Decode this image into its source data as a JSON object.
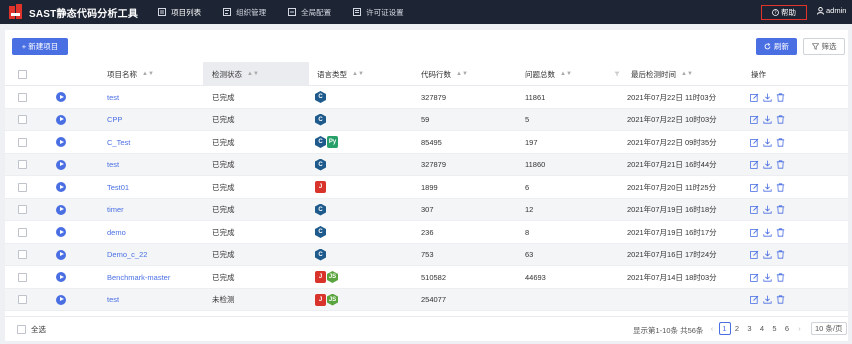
{
  "app": {
    "title": "SAST静态代码分析工具"
  },
  "nav": [
    {
      "label": "项目列表",
      "icon": "list-icon",
      "active": true
    },
    {
      "label": "组织管理",
      "icon": "org-icon",
      "active": false
    },
    {
      "label": "全局配置",
      "icon": "settings-icon",
      "active": false
    },
    {
      "label": "许可证设置",
      "icon": "license-icon",
      "active": false
    }
  ],
  "header": {
    "help_label": "帮助",
    "user_label": "admin"
  },
  "toolbar": {
    "new_label": "+ 新建项目",
    "refresh_label": "刷新",
    "filter_label": "筛选"
  },
  "columns": {
    "name": "项目名称",
    "status": "检测状态",
    "lang": "语言类型",
    "lines": "代码行数",
    "issues": "问题总数",
    "last": "最后检测时间",
    "ops": "操作"
  },
  "rows": [
    {
      "name": "test",
      "status": "已完成",
      "langs": [
        "C"
      ],
      "lines": "327879",
      "issues": "11861",
      "time": "2021年07月22日 11时03分"
    },
    {
      "name": "CPP",
      "status": "已完成",
      "langs": [
        "C"
      ],
      "lines": "59",
      "issues": "5",
      "time": "2021年07月22日 10时03分"
    },
    {
      "name": "C_Test",
      "status": "已完成",
      "langs": [
        "C",
        "Py"
      ],
      "lines": "85495",
      "issues": "197",
      "time": "2021年07月22日 09时35分"
    },
    {
      "name": "test",
      "status": "已完成",
      "langs": [
        "C"
      ],
      "lines": "327879",
      "issues": "11860",
      "time": "2021年07月21日 16时44分"
    },
    {
      "name": "Test01",
      "status": "已完成",
      "langs": [
        "J"
      ],
      "lines": "1899",
      "issues": "6",
      "time": "2021年07月20日 11时25分"
    },
    {
      "name": "timer",
      "status": "已完成",
      "langs": [
        "C"
      ],
      "lines": "307",
      "issues": "12",
      "time": "2021年07月19日 16时18分"
    },
    {
      "name": "demo",
      "status": "已完成",
      "langs": [
        "C"
      ],
      "lines": "236",
      "issues": "8",
      "time": "2021年07月19日 16时17分"
    },
    {
      "name": "Demo_c_22",
      "status": "已完成",
      "langs": [
        "C"
      ],
      "lines": "753",
      "issues": "63",
      "time": "2021年07月16日 17时24分"
    },
    {
      "name": "Benchmark-master",
      "status": "已完成",
      "langs": [
        "J",
        "JS"
      ],
      "lines": "510582",
      "issues": "44693",
      "time": "2021年07月14日 18时03分"
    },
    {
      "name": "test",
      "status": "未检测",
      "langs": [
        "J",
        "JS"
      ],
      "lines": "254077",
      "issues": "",
      "time": ""
    }
  ],
  "footer": {
    "select_all": "全选",
    "total": "显示第1-10条 共56条",
    "pages": [
      "1",
      "2",
      "3",
      "4",
      "5",
      "6"
    ],
    "current_page": "1",
    "per_page": "10 条/页"
  },
  "colors": {
    "accent": "#4a6fe3",
    "topbar": "#1d2433",
    "highlight": "#e0332c"
  }
}
